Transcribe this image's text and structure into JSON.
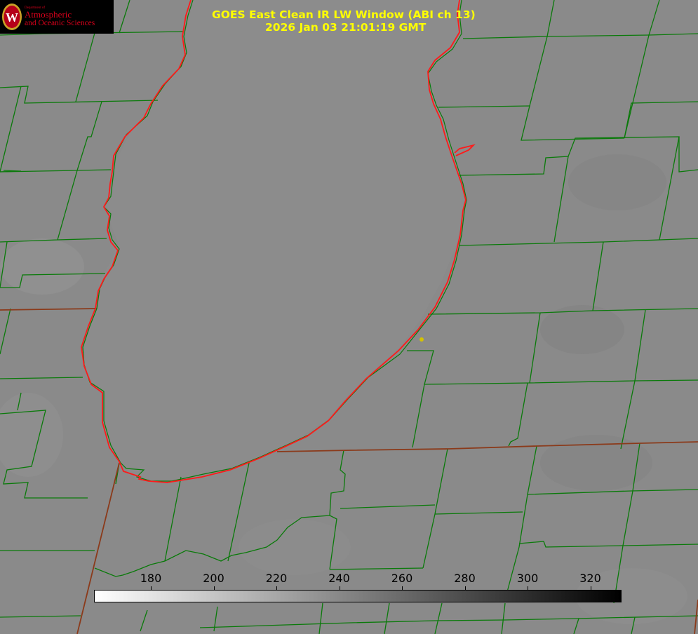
{
  "logo": {
    "dept": "Department of",
    "line1": "Atmospheric",
    "line2": "and Oceanic Sciences",
    "seal_letter": "W"
  },
  "title": {
    "line1": "GOES East Clean IR LW Window (ABI ch 13)",
    "line2": "2026 Jan 03 21:01:19 GMT"
  },
  "colorbar": {
    "ticks": [
      "180",
      "200",
      "220",
      "240",
      "260",
      "280",
      "300",
      "320"
    ],
    "gradient_from": "#ffffff",
    "gradient_to": "#000000"
  },
  "colors": {
    "background": "#8a8a8a",
    "lake": "#8c8c8c",
    "county_lines": "#0a7a0a",
    "state_lines": "#8b3a1a",
    "shoreline": "#ff1a1a",
    "title_text": "#ffff00",
    "station_marker": "#d4c200"
  }
}
